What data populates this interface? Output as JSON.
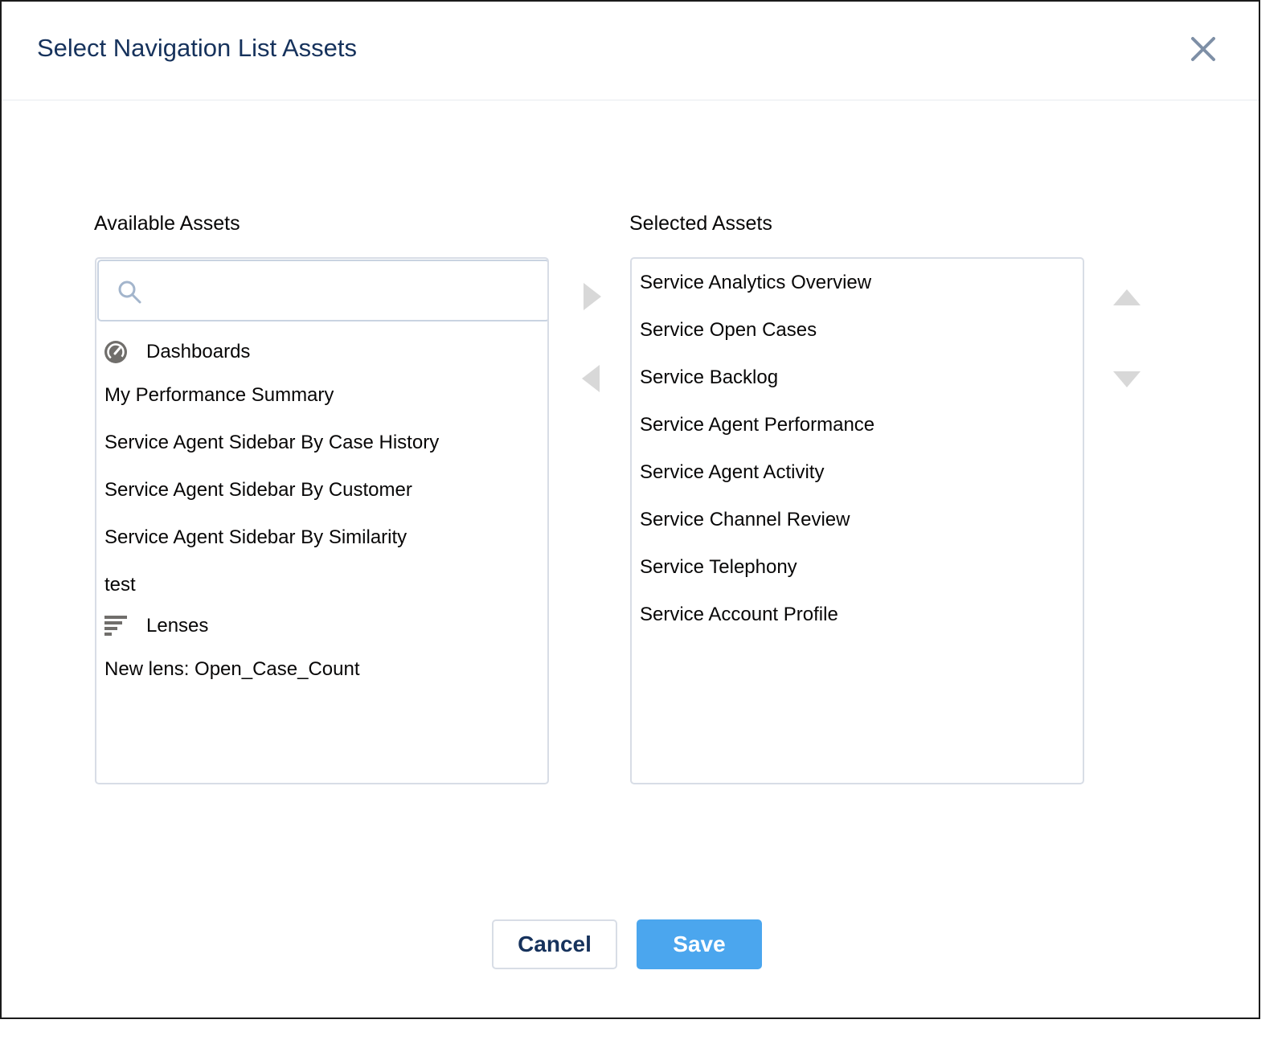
{
  "dialog": {
    "title": "Select Navigation List Assets"
  },
  "available": {
    "label": "Available Assets",
    "search_placeholder": "",
    "groups": [
      {
        "label": "Dashboards",
        "icon": "dashboard-gauge-icon",
        "items": [
          "My Performance Summary",
          "Service Agent Sidebar By Case History",
          "Service Agent Sidebar By Customer",
          "Service Agent Sidebar By Similarity",
          "test"
        ]
      },
      {
        "label": "Lenses",
        "icon": "lens-bars-icon",
        "items": [
          "New lens: Open_Case_Count"
        ]
      }
    ]
  },
  "selected": {
    "label": "Selected Assets",
    "items": [
      "Service Analytics Overview",
      "Service Open Cases",
      "Service Backlog",
      "Service Agent Performance",
      "Service Agent Activity",
      "Service Channel Review",
      "Service Telephony",
      "Service Account Profile"
    ]
  },
  "footer": {
    "cancel_label": "Cancel",
    "save_label": "Save"
  },
  "colors": {
    "title": "#16325c",
    "primary": "#4ba6ee",
    "border": "#d8dde6",
    "arrow_disabled": "#d8d8d8"
  }
}
